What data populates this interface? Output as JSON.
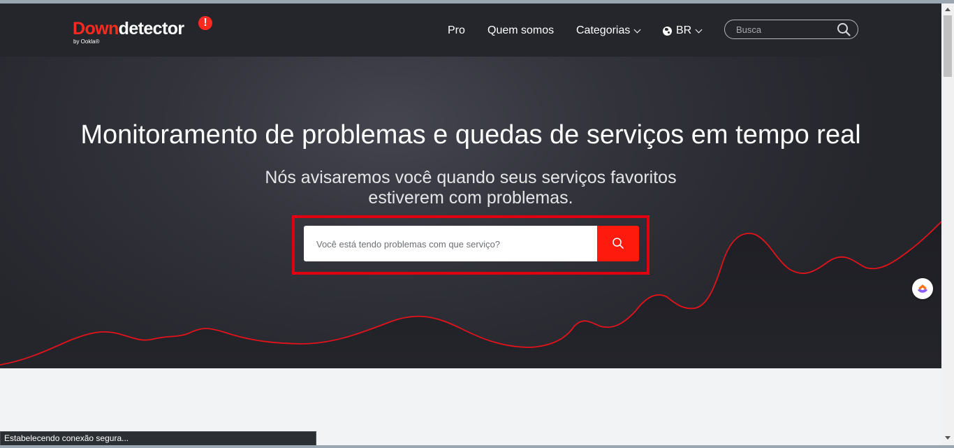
{
  "brand": {
    "name_part1": "Down",
    "name_part2": "detector",
    "badge": "!",
    "sub": "by Ookla®"
  },
  "nav": {
    "pro": "Pro",
    "about": "Quem somos",
    "categories": "Categorias",
    "region": "BR",
    "search_placeholder": "Busca"
  },
  "hero": {
    "title": "Monitoramento de problemas e quedas de serviços em tempo real",
    "subtitle": "Nós avisaremos você quando seus serviços favoritos estiverem com problemas.",
    "search_placeholder": "Você está tendo problemas com que serviço?"
  },
  "status": {
    "text": "Estabelecendo conexão segura..."
  },
  "colors": {
    "accent": "#ff1a0e",
    "hero_bg": "#25262c",
    "highlight_outline": "#e1000f"
  },
  "icons": {
    "search": "search-icon",
    "globe": "globe-icon",
    "extension": "clickup-extension-icon"
  }
}
